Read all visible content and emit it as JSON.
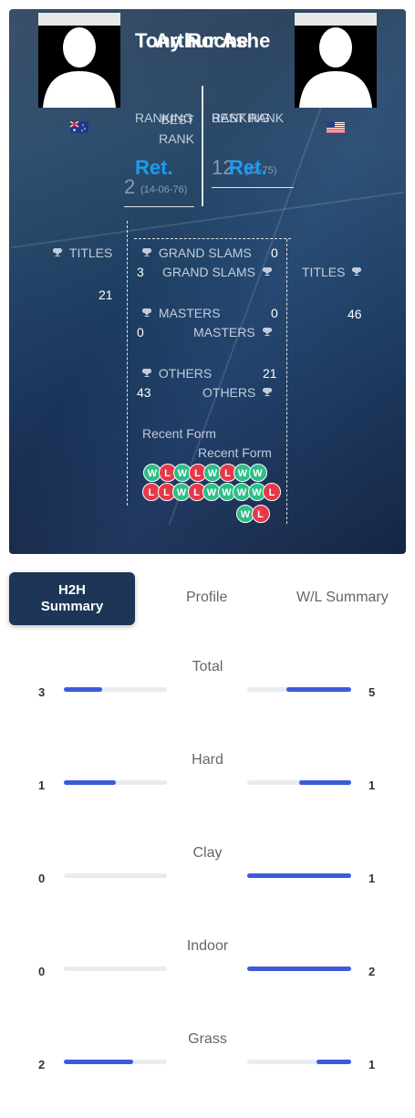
{
  "players": {
    "p1": {
      "name": "Tony Roche",
      "flag": "australia-flag"
    },
    "p2": {
      "name": "Arthur Ashe",
      "flag": "usa-flag"
    }
  },
  "ranks": {
    "p1_ranking_label": "RANKING",
    "p1_best_rank_label": "BEST RANK",
    "p1_ranking": "Ret.",
    "p1_best_rank": "2",
    "p1_best_rank_date": "(14-06-76)",
    "p2_best_rank_label": "BEST RANK",
    "p2_ranking_label": "RANKING",
    "p2_best_rank": "12",
    "p2_best_rank_date": "(12-75)",
    "p2_ranking": "Ret."
  },
  "titles": {
    "label": "TITLES",
    "p1_titles": "21",
    "p2_titles": "46",
    "grand_slams_label": "GRAND SLAMS",
    "p1_grand_slams": "0",
    "p1_grand_slams_total": "3",
    "masters_label": "MASTERS",
    "p1_masters": "0",
    "p2_masters": "0",
    "others_label": "OTHERS",
    "p1_others": "21",
    "p2_others": "43"
  },
  "recent_form": {
    "label": "Recent Form",
    "p1": [
      "W",
      "L",
      "W",
      "L",
      "W",
      "L",
      "W",
      "W"
    ],
    "p2_row1": [
      "L",
      "L",
      "W",
      "L",
      "W",
      "W",
      "W",
      "W",
      "L"
    ],
    "p2_row2": [
      "W",
      "L"
    ]
  },
  "tabs": {
    "h2h": "H2H Summary",
    "profile": "Profile",
    "wl": "W/L Summary"
  },
  "stats": [
    {
      "label": "Total",
      "p1": "3",
      "p2": "5",
      "p1_fill": 0.37,
      "p2_fill": 0.62
    },
    {
      "label": "Hard",
      "p1": "1",
      "p2": "1",
      "p1_fill": 0.5,
      "p2_fill": 0.5
    },
    {
      "label": "Clay",
      "p1": "0",
      "p2": "1",
      "p1_fill": 0.0,
      "p2_fill": 1.0
    },
    {
      "label": "Indoor",
      "p1": "0",
      "p2": "2",
      "p1_fill": 0.0,
      "p2_fill": 1.0
    },
    {
      "label": "Grass",
      "p1": "2",
      "p2": "1",
      "p1_fill": 0.67,
      "p2_fill": 0.33
    }
  ],
  "colors": {
    "accent": "#3b5bdb",
    "ret": "#1e9bf0",
    "win": "#2cbf86",
    "loss": "#e5394a",
    "tab_active": "#1d3557"
  }
}
